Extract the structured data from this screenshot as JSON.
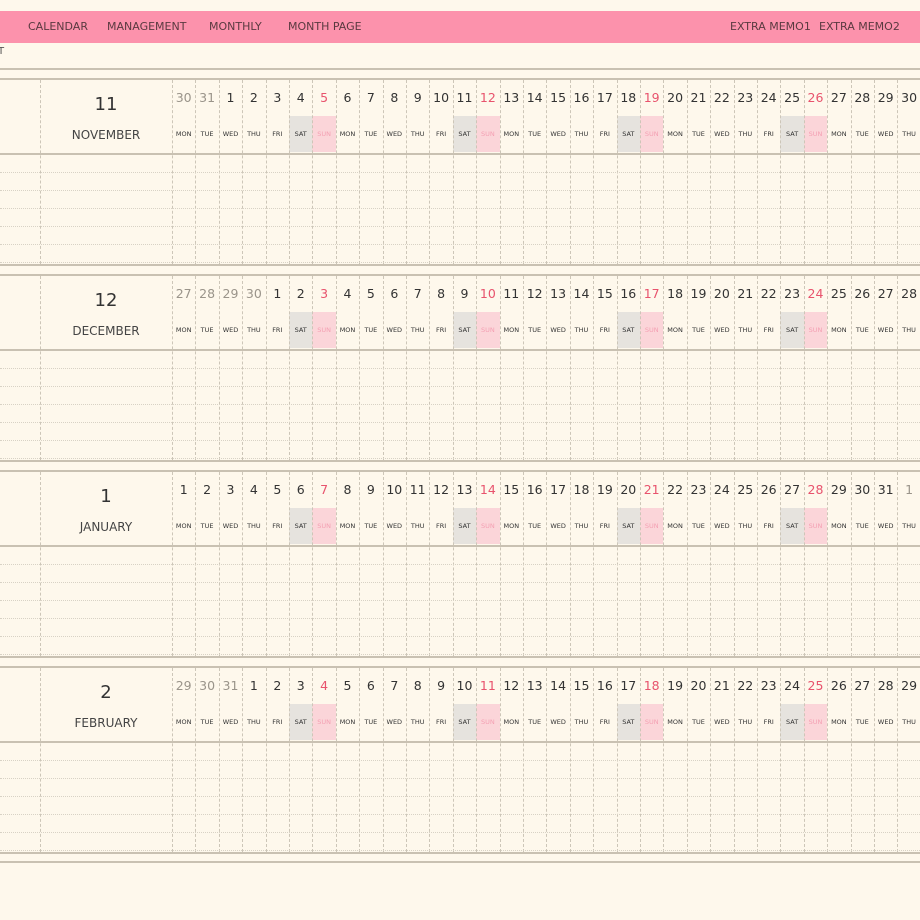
{
  "nav": {
    "calendar": "CALENDAR",
    "management": "MANAGEMENT",
    "monthly": "MONTHLY",
    "month_page": "MONTH PAGE",
    "extra_memo1": "EXTRA MEMO1",
    "extra_memo2": "EXTRA MEMO2"
  },
  "corner_text": "T",
  "weekday_labels": [
    "MON",
    "TUE",
    "WED",
    "THU",
    "FRI",
    "SAT",
    "SUN"
  ],
  "colors": {
    "topbar": "#fc92ac",
    "background": "#fef8ec",
    "sunday_text": "#e8536d",
    "sunday_bg": "#fbd5d9",
    "saturday_bg": "#e6e3de"
  },
  "months": [
    {
      "number": "11",
      "name": "NOVEMBER",
      "days": [
        {
          "d": "30",
          "other": true
        },
        {
          "d": "31",
          "other": true
        },
        {
          "d": "1"
        },
        {
          "d": "2"
        },
        {
          "d": "3"
        },
        {
          "d": "4"
        },
        {
          "d": "5"
        },
        {
          "d": "6"
        },
        {
          "d": "7"
        },
        {
          "d": "8"
        },
        {
          "d": "9"
        },
        {
          "d": "10"
        },
        {
          "d": "11"
        },
        {
          "d": "12"
        },
        {
          "d": "13"
        },
        {
          "d": "14"
        },
        {
          "d": "15"
        },
        {
          "d": "16"
        },
        {
          "d": "17"
        },
        {
          "d": "18"
        },
        {
          "d": "19"
        },
        {
          "d": "20"
        },
        {
          "d": "21"
        },
        {
          "d": "22"
        },
        {
          "d": "23"
        },
        {
          "d": "24"
        },
        {
          "d": "25"
        },
        {
          "d": "26"
        },
        {
          "d": "27"
        },
        {
          "d": "28"
        },
        {
          "d": "29"
        },
        {
          "d": "30"
        }
      ]
    },
    {
      "number": "12",
      "name": "DECEMBER",
      "days": [
        {
          "d": "27",
          "other": true
        },
        {
          "d": "28",
          "other": true
        },
        {
          "d": "29",
          "other": true
        },
        {
          "d": "30",
          "other": true
        },
        {
          "d": "1"
        },
        {
          "d": "2"
        },
        {
          "d": "3"
        },
        {
          "d": "4"
        },
        {
          "d": "5"
        },
        {
          "d": "6"
        },
        {
          "d": "7"
        },
        {
          "d": "8"
        },
        {
          "d": "9"
        },
        {
          "d": "10"
        },
        {
          "d": "11"
        },
        {
          "d": "12"
        },
        {
          "d": "13"
        },
        {
          "d": "14"
        },
        {
          "d": "15"
        },
        {
          "d": "16"
        },
        {
          "d": "17"
        },
        {
          "d": "18"
        },
        {
          "d": "19"
        },
        {
          "d": "20"
        },
        {
          "d": "21"
        },
        {
          "d": "22"
        },
        {
          "d": "23"
        },
        {
          "d": "24"
        },
        {
          "d": "25"
        },
        {
          "d": "26"
        },
        {
          "d": "27"
        },
        {
          "d": "28"
        }
      ]
    },
    {
      "number": "1",
      "name": "JANUARY",
      "days": [
        {
          "d": "1"
        },
        {
          "d": "2"
        },
        {
          "d": "3"
        },
        {
          "d": "4"
        },
        {
          "d": "5"
        },
        {
          "d": "6"
        },
        {
          "d": "7"
        },
        {
          "d": "8"
        },
        {
          "d": "9"
        },
        {
          "d": "10"
        },
        {
          "d": "11"
        },
        {
          "d": "12"
        },
        {
          "d": "13"
        },
        {
          "d": "14"
        },
        {
          "d": "15"
        },
        {
          "d": "16"
        },
        {
          "d": "17"
        },
        {
          "d": "18"
        },
        {
          "d": "19"
        },
        {
          "d": "20"
        },
        {
          "d": "21"
        },
        {
          "d": "22"
        },
        {
          "d": "23"
        },
        {
          "d": "24"
        },
        {
          "d": "25"
        },
        {
          "d": "26"
        },
        {
          "d": "27"
        },
        {
          "d": "28"
        },
        {
          "d": "29"
        },
        {
          "d": "30"
        },
        {
          "d": "31"
        },
        {
          "d": "1",
          "other": true
        }
      ]
    },
    {
      "number": "2",
      "name": "FEBRUARY",
      "days": [
        {
          "d": "29",
          "other": true
        },
        {
          "d": "30",
          "other": true
        },
        {
          "d": "31",
          "other": true
        },
        {
          "d": "1"
        },
        {
          "d": "2"
        },
        {
          "d": "3"
        },
        {
          "d": "4"
        },
        {
          "d": "5"
        },
        {
          "d": "6"
        },
        {
          "d": "7"
        },
        {
          "d": "8"
        },
        {
          "d": "9"
        },
        {
          "d": "10"
        },
        {
          "d": "11"
        },
        {
          "d": "12"
        },
        {
          "d": "13"
        },
        {
          "d": "14"
        },
        {
          "d": "15"
        },
        {
          "d": "16"
        },
        {
          "d": "17"
        },
        {
          "d": "18"
        },
        {
          "d": "19"
        },
        {
          "d": "20"
        },
        {
          "d": "21"
        },
        {
          "d": "22"
        },
        {
          "d": "23"
        },
        {
          "d": "24"
        },
        {
          "d": "25"
        },
        {
          "d": "26"
        },
        {
          "d": "27"
        },
        {
          "d": "28"
        },
        {
          "d": "29"
        }
      ]
    }
  ]
}
